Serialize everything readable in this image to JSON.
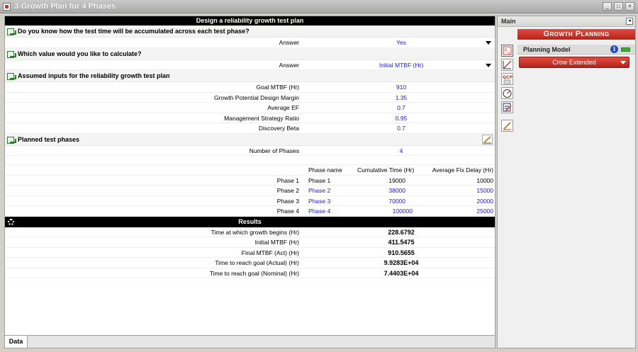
{
  "window": {
    "title": "3-Growth Plan for 4 Phases"
  },
  "sheet": {
    "header": "Design a reliability growth test plan",
    "q1": {
      "text": "Do you know how the test time will be accumulated across each test phase?",
      "label": "Answer",
      "value": "Yes"
    },
    "q2": {
      "text": "Which value would you like to calculate?",
      "label": "Answer",
      "value": "Initial MTBF (Hr)"
    },
    "inputs": {
      "title": "Assumed inputs for the reliability growth test plan",
      "rows": [
        {
          "label": "Goal MTBF (Hr)",
          "value": "910"
        },
        {
          "label": "Growth Potential Design Margin",
          "value": "1.35"
        },
        {
          "label": "Average EF",
          "value": "0.7"
        },
        {
          "label": "Management Strategy Ratio",
          "value": "0.95"
        },
        {
          "label": "Discovery Beta",
          "value": "0.7"
        }
      ]
    },
    "phases": {
      "title": "Planned test phases",
      "count_label": "Number of Phases",
      "count_value": "4",
      "col_name": "Phase name",
      "col_time": "Cumulative Time (Hr)",
      "col_delay": "Average Fix Delay (Hr)",
      "rows": [
        {
          "label": "Phase 1",
          "name": "Phase 1",
          "time": "19000",
          "delay": "10000"
        },
        {
          "label": "Phase 2",
          "name": "Phase 2",
          "time": "38000",
          "delay": "15000"
        },
        {
          "label": "Phase 3",
          "name": "Phase 3",
          "time": "70000",
          "delay": "20000"
        },
        {
          "label": "Phase 4",
          "name": "Phase 4",
          "time": "100000",
          "delay": "25000"
        }
      ]
    },
    "results": {
      "title": "Results",
      "rows": [
        {
          "label": "Time at which growth begins (Hr)",
          "value": "228.6792"
        },
        {
          "label": "Initial MTBF (Hr)",
          "value": "411.5475"
        },
        {
          "label": "Final MTBF (Act) (Hr)",
          "value": "910.5655"
        },
        {
          "label": "Time to reach goal (Actual) (Hr)",
          "value": "9.9283E+04"
        },
        {
          "label": "Time to reach goal (Nominal) (Hr)",
          "value": "7.4403E+04"
        }
      ]
    }
  },
  "tabs": {
    "data": "Data"
  },
  "side": {
    "header": "Main",
    "banner": "Growth Planning",
    "planning_model_label": "Planning Model",
    "planning_model_value": "Crow Extended"
  },
  "colors": {
    "accent_red": "#c0392b",
    "value_blue": "#1c1ccf"
  }
}
